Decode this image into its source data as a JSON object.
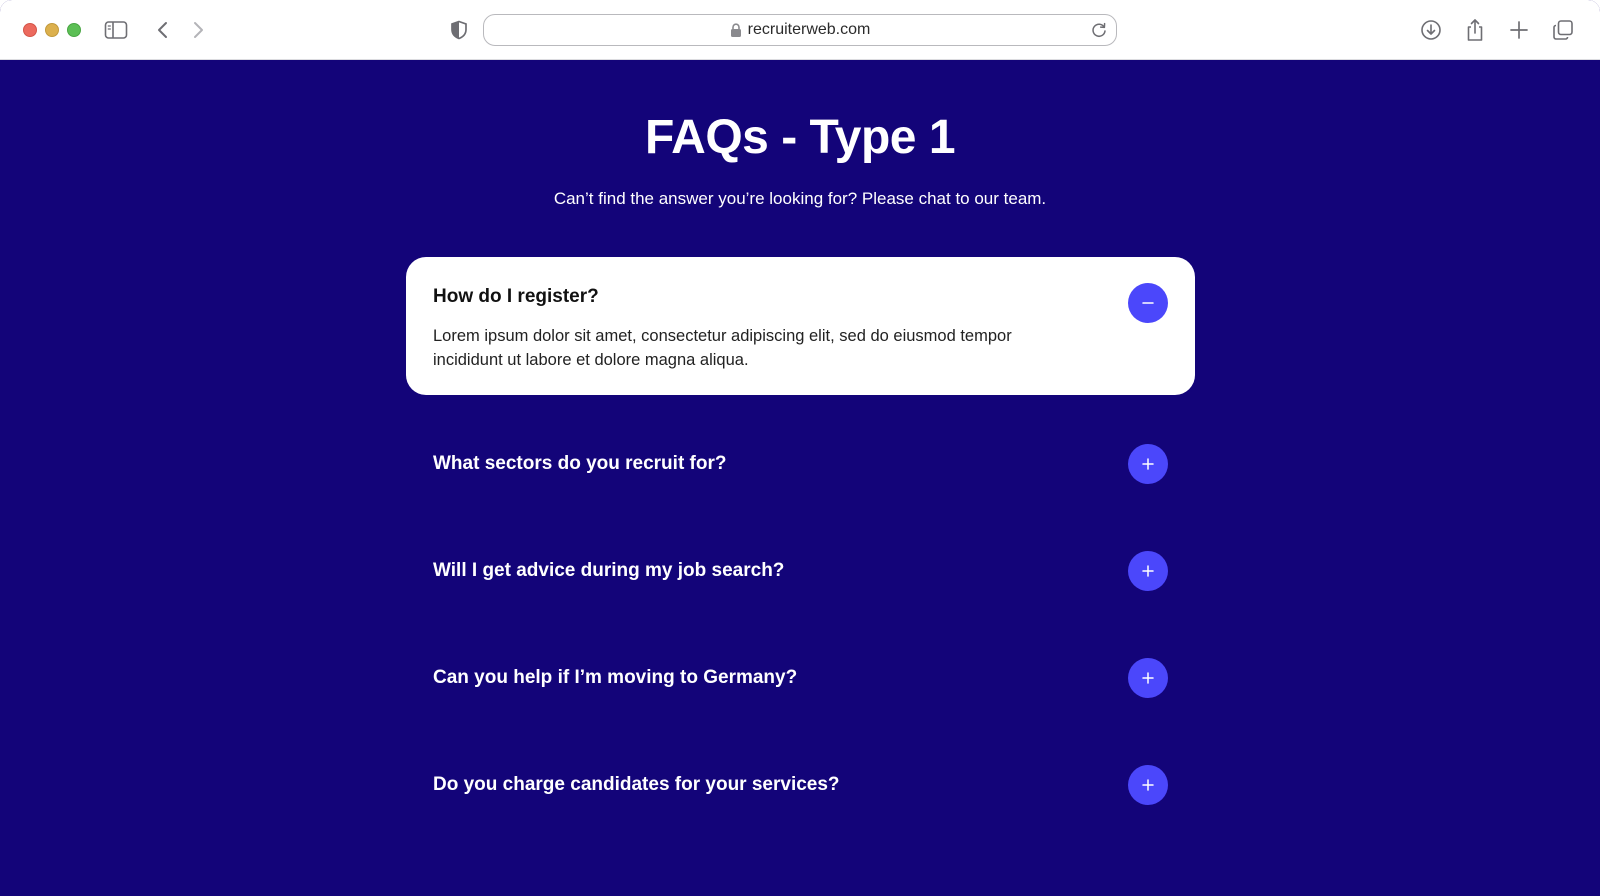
{
  "browser": {
    "url": "recruiterweb.com"
  },
  "page": {
    "title": "FAQs - Type 1",
    "subtitle": "Can’t find the answer you’re looking for? Please chat to our team."
  },
  "faqs": [
    {
      "question": "How do I register?",
      "answer": "Lorem ipsum dolor sit amet, consectetur adipiscing elit, sed do eiusmod tempor incididunt ut labore et dolore magna aliqua.",
      "expanded": true
    },
    {
      "question": "What sectors do you recruit for?",
      "expanded": false
    },
    {
      "question": "Will I get advice during my job search?",
      "expanded": false
    },
    {
      "question": "Can you help if I’m moving to Germany?",
      "expanded": false
    },
    {
      "question": "Do you charge candidates for your services?",
      "expanded": false
    }
  ],
  "colors": {
    "background": "#130479",
    "accent": "#4b47fb",
    "card": "#ffffff"
  }
}
